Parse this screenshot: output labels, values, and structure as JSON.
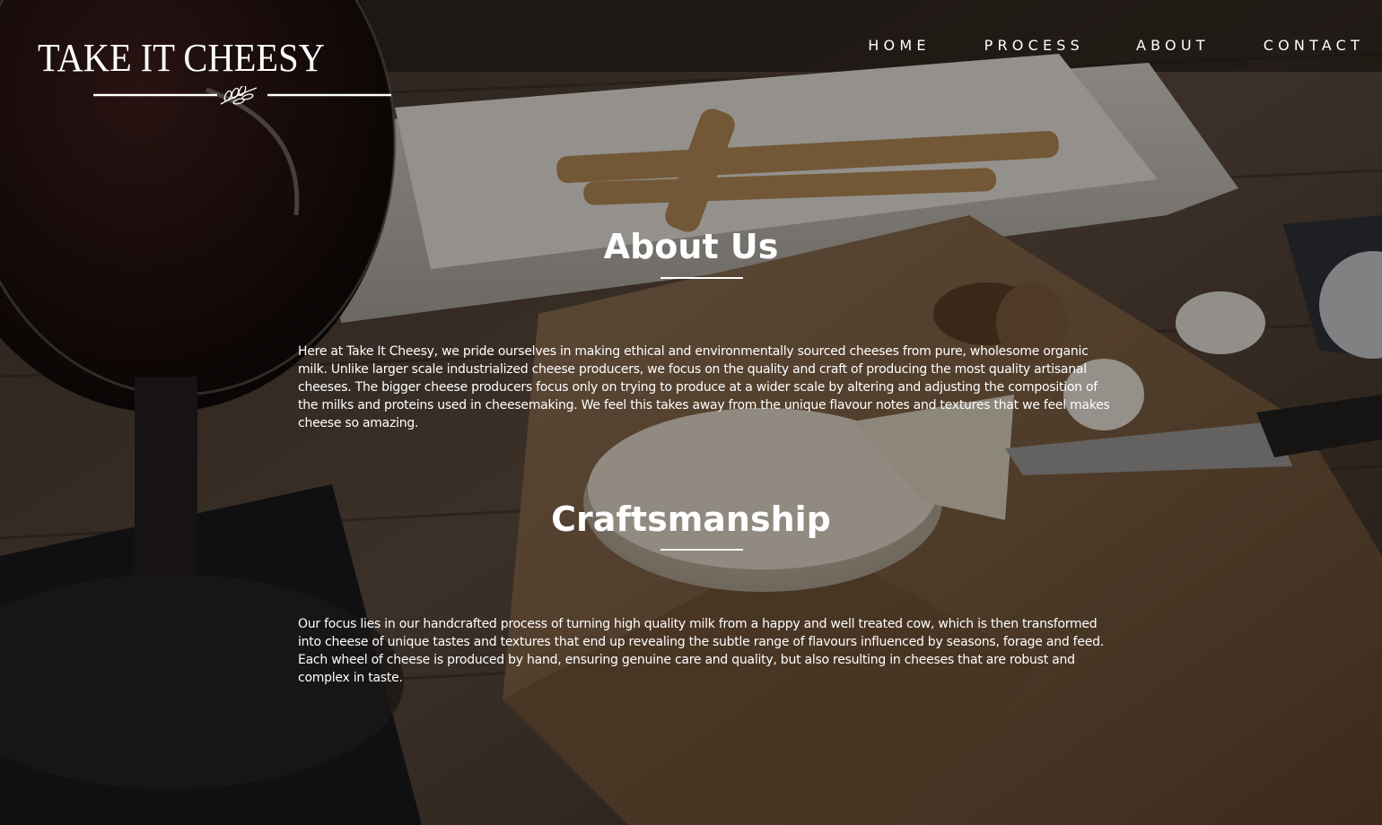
{
  "brand": {
    "name": "TAKE IT CHEESY"
  },
  "nav": {
    "home": "HOME",
    "process": "PROCESS",
    "about": "ABOUT",
    "contact": "CONTACT"
  },
  "about": {
    "title": "About Us",
    "body": "Here at Take It Cheesy, we pride ourselves in making ethical and environmentally sourced cheeses from pure, wholesome organic milk. Unlike larger scale industrialized cheese producers, we focus on the quality and craft of producing the most quality artisanal cheeses. The bigger cheese producers focus only on trying to produce at a wider scale by altering and adjusting the composition of the milks and proteins used in cheesemaking. We feel this takes away from the unique flavour notes and textures that we feel makes cheese so amazing."
  },
  "craftsmanship": {
    "title": "Craftsmanship",
    "body": "Our focus lies in our handcrafted process of turning high quality milk from a happy and well treated cow, which is then transformed into cheese of unique tastes and textures that end up revealing the subtle range of flavours influenced by seasons, forage and feed. Each wheel of cheese is produced by hand, ensuring genuine care and quality, but also resulting in cheeses that are robust and complex in taste."
  },
  "icons": {
    "logo_ornament": "olive-branch-icon"
  },
  "colors": {
    "text": "#ffffff",
    "overlay": "#0a0806"
  }
}
